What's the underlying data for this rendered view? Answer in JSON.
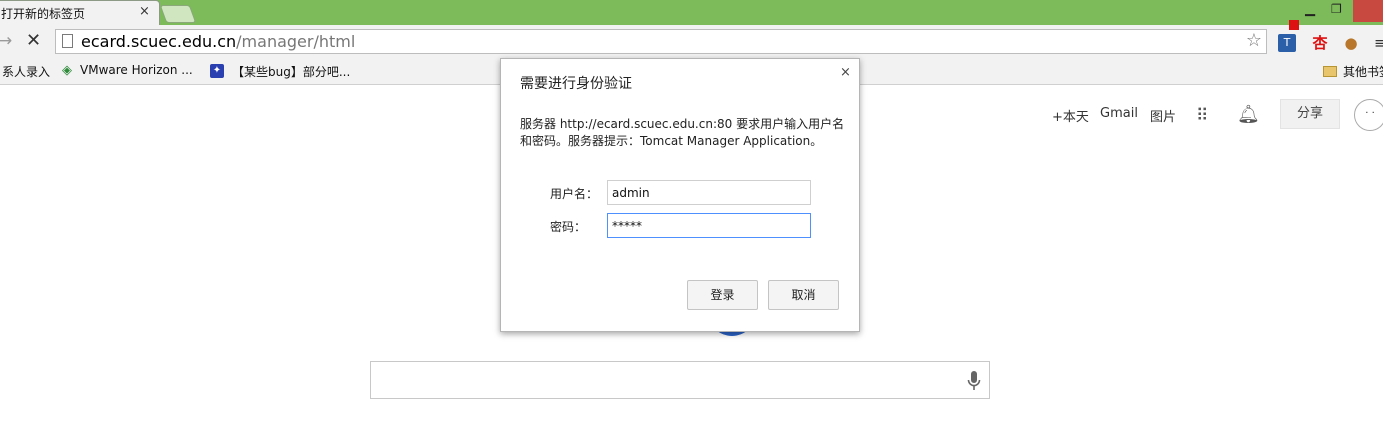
{
  "browser": {
    "tab": {
      "title": "打开新的标签页",
      "close_glyph": "×"
    },
    "window_controls": {
      "minimize": "▁",
      "maximize": "❐"
    },
    "toolbar": {
      "forward_glyph": "→",
      "stop_glyph": "✕",
      "url_host": "ecard.scuec.edu.cn",
      "url_path": "/manager/html",
      "star_glyph": "☆",
      "extensions": [
        {
          "name": "translate-extension-icon",
          "glyph": "T"
        },
        {
          "name": "xing-extension-icon",
          "glyph": "杏"
        },
        {
          "name": "cookie-extension-icon",
          "glyph": "●"
        }
      ],
      "menu_glyph": "≡"
    },
    "bookmarks": [
      {
        "label": "系人录入"
      },
      {
        "label": "VMware Horizon ..."
      },
      {
        "label": "【某些bug】部分吧..."
      },
      {
        "label": "其他书签"
      }
    ]
  },
  "google_bar": {
    "plus_label": "+本天",
    "gmail_label": "Gmail",
    "images_label": "图片",
    "share_label": "分享",
    "avatar_text": "·  ·"
  },
  "auth_dialog": {
    "title": "需要进行身份验证",
    "close_glyph": "×",
    "message": "服务器 http://ecard.scuec.edu.cn:80 要求用户输入用户名和密码。服务器提示：Tomcat Manager Application。",
    "username_label": "用户名：",
    "username_value": "admin",
    "password_label": "密码：",
    "password_value": "*****",
    "login_label": "登录",
    "cancel_label": "取消"
  },
  "colors": {
    "titlebar": "#7cba5a",
    "focus_border": "#4d90fe",
    "close_button": "#c7493f"
  }
}
